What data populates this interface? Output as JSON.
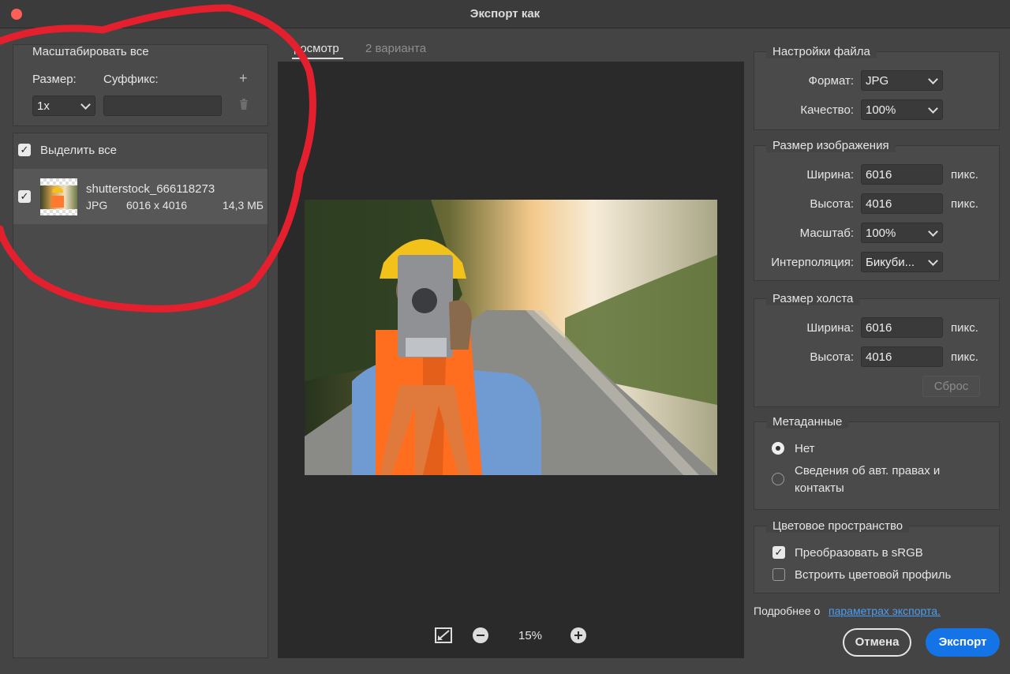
{
  "window": {
    "title": "Экспорт как"
  },
  "left": {
    "scale_all": "Масштабировать все",
    "size_label": "Размер:",
    "suffix_label": "Суффикс:",
    "add_icon": "+",
    "size_value": "1x",
    "suffix_value": "",
    "select_all": "Выделить все",
    "file": {
      "name": "shutterstock_666118273",
      "format": "JPG",
      "dimensions": "6016 x 4016",
      "filesize": "14,3 МБ"
    }
  },
  "tabs": [
    {
      "label": "росмотр",
      "active": true
    },
    {
      "label": "2 варианта",
      "active": false
    }
  ],
  "zoom": {
    "value": "15%"
  },
  "file_settings": {
    "heading": "Настройки файла",
    "format_label": "Формат:",
    "format_value": "JPG",
    "quality_label": "Качество:",
    "quality_value": "100%"
  },
  "image_size": {
    "heading": "Размер изображения",
    "width_label": "Ширина:",
    "width_value": "6016",
    "height_label": "Высота:",
    "height_value": "4016",
    "unit": "пикс.",
    "scale_label": "Масштаб:",
    "scale_value": "100%",
    "interp_label": "Интерполяция:",
    "interp_value": "Бикуби..."
  },
  "canvas_size": {
    "heading": "Размер холста",
    "width_label": "Ширина:",
    "width_value": "6016",
    "height_label": "Высота:",
    "height_value": "4016",
    "unit": "пикс.",
    "reset": "Сброс"
  },
  "metadata": {
    "heading": "Метаданные",
    "none": "Нет",
    "copyright_line1": "Сведения об авт. правах и",
    "copyright_line2": "контакты"
  },
  "color_space": {
    "heading": "Цветовое пространство",
    "convert": "Преобразовать в sRGB",
    "embed": "Встроить цветовой профиль"
  },
  "footer": {
    "more_text": "Подробнее о",
    "more_link": "параметрах экспорта.",
    "cancel": "Отмена",
    "export": "Экспорт"
  },
  "colors": {
    "accent": "#1473e6",
    "annotation": "#e5202e"
  }
}
